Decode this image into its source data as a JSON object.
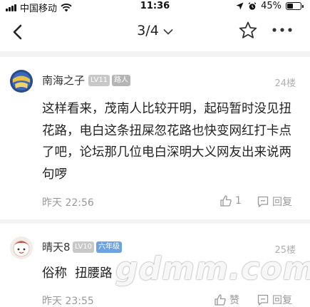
{
  "status_bar": {
    "carrier": "中国移动",
    "time": "11:36",
    "battery": "45%",
    "battery_level": 0.45
  },
  "nav": {
    "pager": "3/4"
  },
  "posts": [
    {
      "username": "南海之子",
      "level": "LV11",
      "tag": "路人",
      "floor": "24楼",
      "content": "这样看来，茂南人比较开明，起码暂时没见扭花路，电白这条扭屎忽花路也快变网红打卡点了吧，论坛那几位电白深明大义网友出来说两句啰",
      "time": "昨天 22:56",
      "like": "1",
      "reply": "回复"
    },
    {
      "username": "晴天8",
      "level": "LV10",
      "tag": "六年级",
      "floor": "25楼",
      "content": "俗称  扭腰路",
      "time": "昨天 23:55",
      "like": "赞",
      "reply": "回复"
    }
  ],
  "watermark": "gdmm.com",
  "colors": {
    "level_badge": "#c8c8c8",
    "tag_luren": "#b5b5b5",
    "tag_grade": "#6fa3e0",
    "muted": "#999999"
  }
}
